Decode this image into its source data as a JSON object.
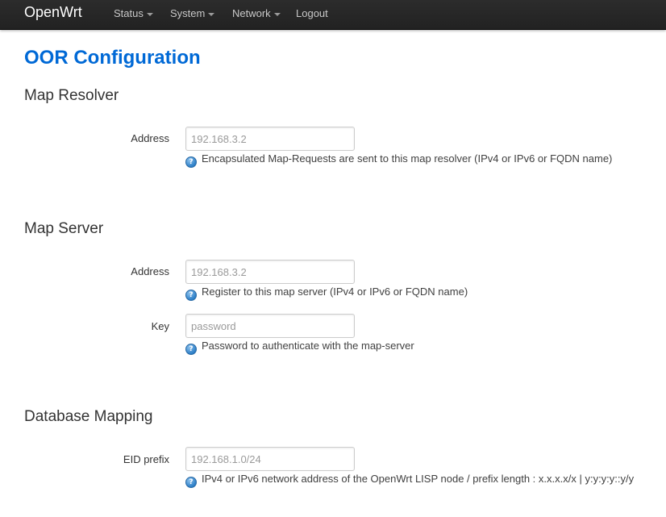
{
  "navbar": {
    "brand": "OpenWrt",
    "items": [
      {
        "label": "Status",
        "dropdown": true
      },
      {
        "label": "System",
        "dropdown": true
      },
      {
        "label": "Network",
        "dropdown": true
      },
      {
        "label": "Logout",
        "dropdown": false
      }
    ]
  },
  "page": {
    "title": "OOR Configuration"
  },
  "sections": {
    "map_resolver": {
      "title": "Map Resolver",
      "address": {
        "label": "Address",
        "placeholder": "192.168.3.2",
        "value": "",
        "help": "Encapsulated Map-Requests are sent to this map resolver (IPv4 or IPv6 or FQDN name)"
      }
    },
    "map_server": {
      "title": "Map Server",
      "address": {
        "label": "Address",
        "placeholder": "192.168.3.2",
        "value": "",
        "help": "Register to this map server (IPv4 or IPv6 or FQDN name)"
      },
      "key": {
        "label": "Key",
        "placeholder": "password",
        "value": "",
        "help": "Password to authenticate with the map-server"
      }
    },
    "database_mapping": {
      "title": "Database Mapping",
      "eid_prefix": {
        "label": "EID prefix",
        "placeholder": "192.168.1.0/24",
        "value": "",
        "help": "IPv4 or IPv6 network address of the OpenWrt LISP node / prefix length : x.x.x.x/x | y:y:y:y::y/y"
      }
    }
  },
  "icons": {
    "help": "help-icon",
    "dropdown": "caret-down-icon"
  },
  "colors": {
    "navbar_bg": "#222222",
    "title": "#0069d6",
    "help_icon": "#2d7fc7"
  }
}
